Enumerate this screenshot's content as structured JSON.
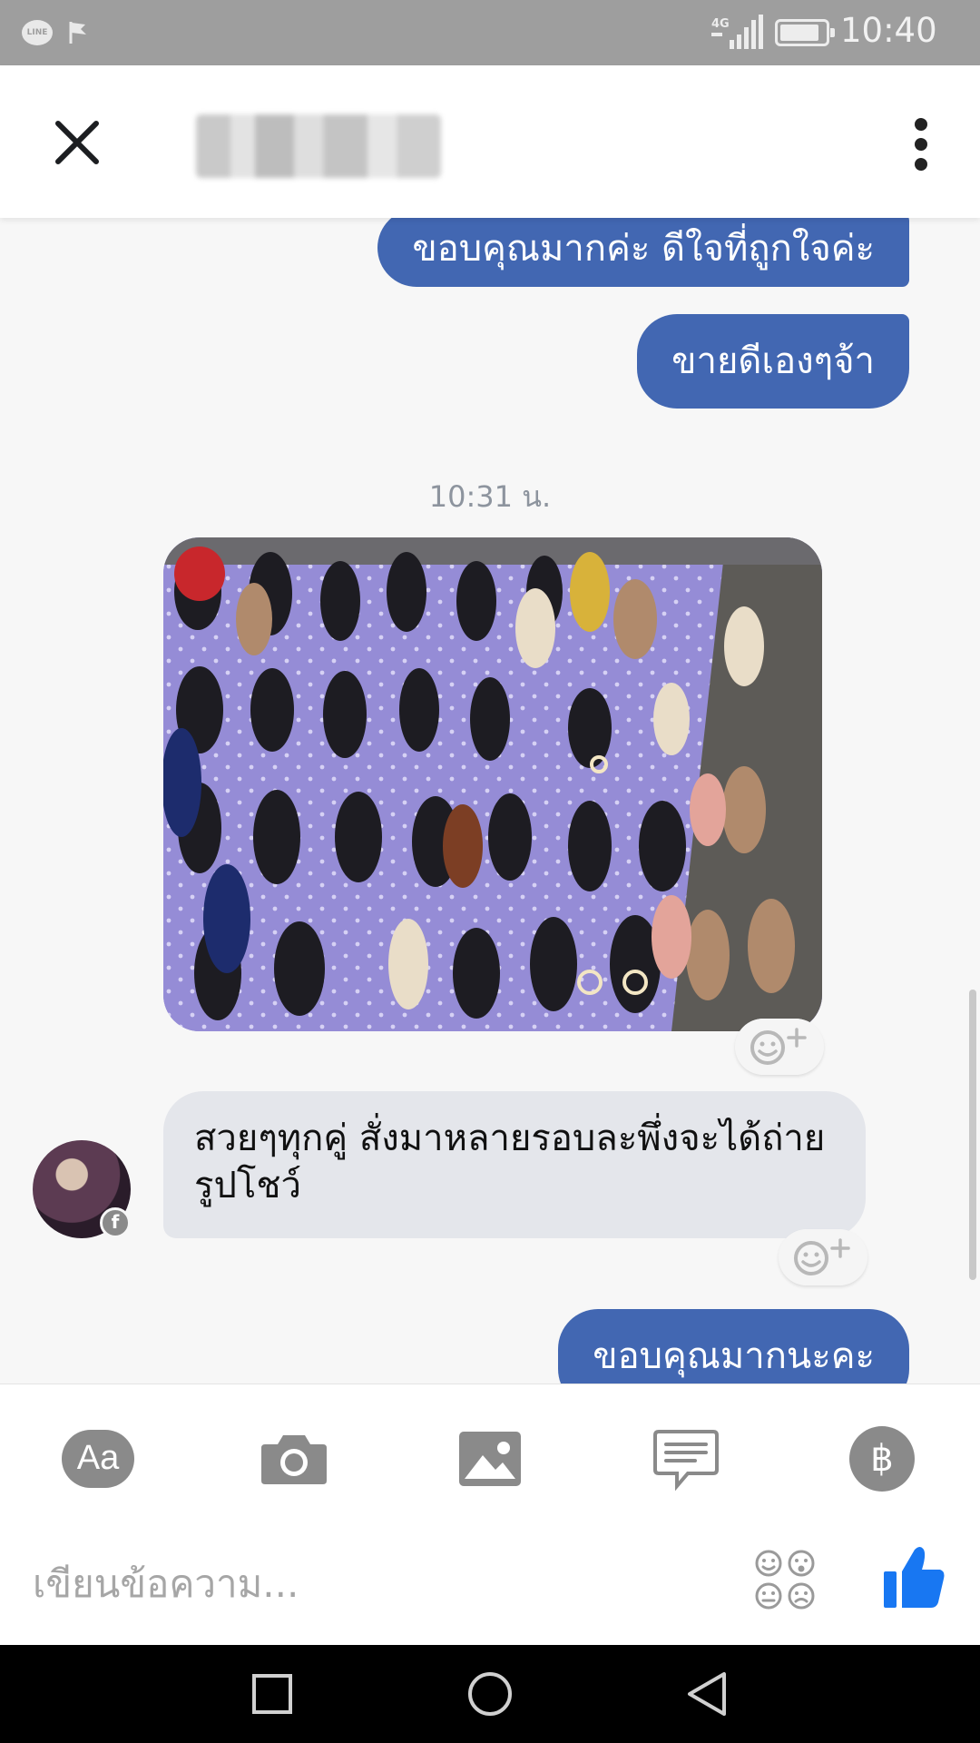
{
  "status_bar": {
    "line_app": "LINE",
    "network": "4G",
    "time": "10:40 น."
  },
  "header": {
    "contact_name": "",
    "close_icon": "close-icon",
    "more_icon": "more-vertical-icon"
  },
  "messages": {
    "outgoing_1": "ขอบคุณมากค่ะ ดีใจที่ถูกใจค่ะ",
    "outgoing_2": "ขายดีเองๆจ้า",
    "timestamp": "10:31 น.",
    "incoming_1": "สวยๆทุกคู่ สั่งมาหลายรอบละพึ่งจะได้ถ่ายรูปโชว์",
    "outgoing_3": "ขอบคุณมากนะคะ",
    "reaction_icon": "add-reaction-icon",
    "avatar_badge": "f"
  },
  "composer": {
    "aa_label": "Aa",
    "pay_label": "฿",
    "placeholder": "เขียนข้อความ..."
  },
  "colors": {
    "outgoing_bubble": "#4267b2",
    "incoming_bubble": "#e4e6eb",
    "like": "#1877f2",
    "tool_gray": "#8a8a8a"
  },
  "navbar": {
    "recent_icon": "square-icon",
    "home_icon": "circle-icon",
    "back_icon": "triangle-back-icon"
  }
}
